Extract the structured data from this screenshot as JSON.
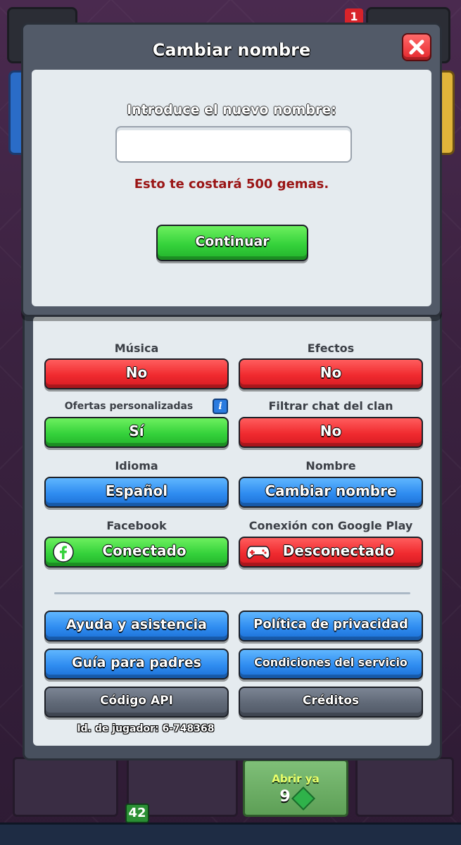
{
  "background": {
    "notification_count": "1",
    "chest_label": "Abrir ya",
    "chest_gem_cost": "9",
    "bottom_count": "42"
  },
  "dialog": {
    "title": "Cambiar nombre",
    "close_icon": "close-icon",
    "prompt": "Introduce el nuevo nombre:",
    "input_value": "",
    "input_placeholder": "",
    "cost_text": "Esto te costará 500 gemas.",
    "continue_label": "Continuar"
  },
  "settings": {
    "music": {
      "label": "Música",
      "value": "No"
    },
    "effects": {
      "label": "Efectos",
      "value": "No"
    },
    "offers": {
      "label": "Ofertas personalizadas",
      "info": "i",
      "value": "Sí"
    },
    "clan_chat": {
      "label": "Filtrar chat del clan",
      "value": "No"
    },
    "language": {
      "label": "Idioma",
      "value": "Español"
    },
    "name": {
      "label": "Nombre",
      "value": "Cambiar nombre"
    },
    "facebook": {
      "label": "Facebook",
      "value": "Conectado",
      "icon": "facebook-icon"
    },
    "google_play": {
      "label": "Conexión con Google  Play",
      "value": "Desconectado",
      "icon": "gamepad-icon"
    },
    "links": {
      "help": "Ayuda y asistencia",
      "privacy": "Política de privacidad",
      "parents": "Guía para padres",
      "terms": "Condiciones del servicio",
      "api": "Código API",
      "credits": "Créditos"
    },
    "player_id": "Id. de jugador: 6-748368"
  },
  "colors": {
    "red_button": "#f02a2f",
    "green_button": "#35d23b",
    "blue_button": "#2f8cf0",
    "gray_button": "#5f6876",
    "cost_text": "#9a1515",
    "panel_bg": "#e5ebef"
  }
}
